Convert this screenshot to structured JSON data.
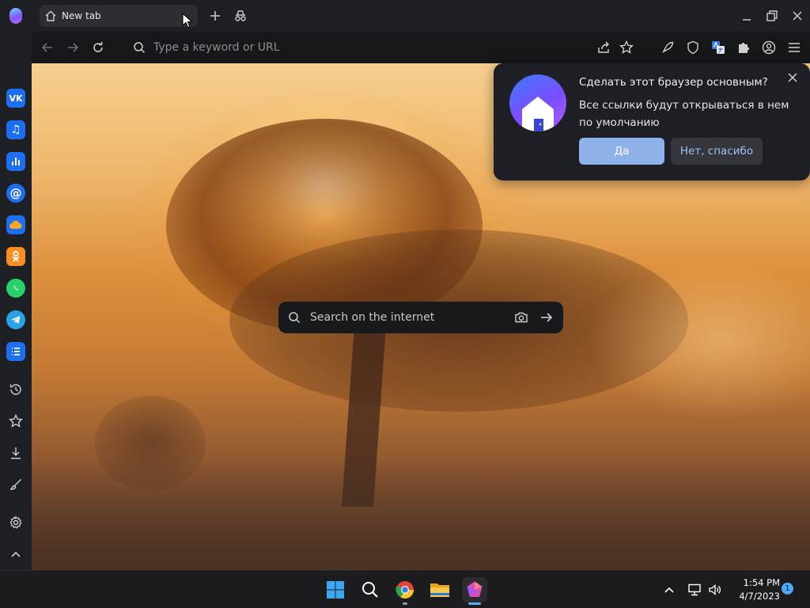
{
  "tab": {
    "title": "New tab"
  },
  "address_bar": {
    "placeholder": "Type a keyword or URL"
  },
  "search": {
    "placeholder": "Search on the internet"
  },
  "popup": {
    "title": "Сделать этот браузер основным?",
    "body": "Все ссылки будут открываться в нем по умолчанию",
    "yes_label": "Да",
    "no_label": "Нет, спасибо"
  },
  "sidebar": {
    "apps": [
      {
        "name": "vk",
        "text": "VK",
        "color": "#1e6ff0"
      },
      {
        "name": "music",
        "text": "♫",
        "color": "#1e6ff0"
      },
      {
        "name": "stats",
        "text": "",
        "color": "#1e6ff0"
      },
      {
        "name": "mail",
        "text": "@",
        "color": "#1e6ff0"
      },
      {
        "name": "cloud",
        "text": "",
        "color": "#1e6ff0"
      },
      {
        "name": "ok",
        "text": "",
        "color": "#f58d1f"
      },
      {
        "name": "whatsapp",
        "text": "",
        "color": "#25d366"
      },
      {
        "name": "telegram",
        "text": "",
        "color": "#2aa3e6"
      },
      {
        "name": "list",
        "text": "",
        "color": "#1e6ff0"
      }
    ]
  },
  "taskbar": {
    "time": "1:54 PM",
    "date": "4/7/2023",
    "notifications": "1"
  },
  "colors": {
    "accent": "#8fb2ec",
    "popup_bg": "#1e1f24",
    "toolbar_bg": "#16171b"
  }
}
